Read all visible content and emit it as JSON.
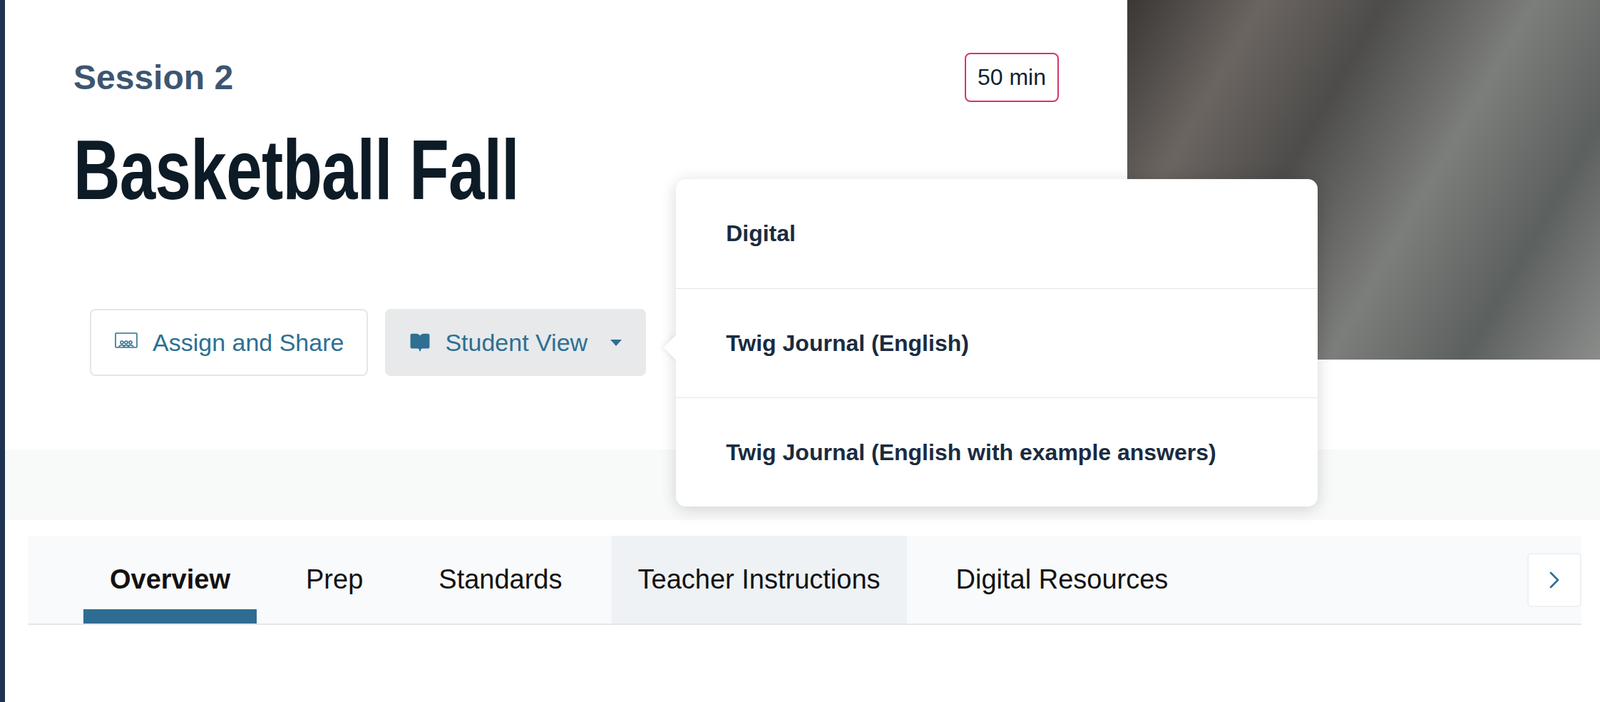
{
  "header": {
    "session": "Session 2",
    "duration": "50 min",
    "title": "Basketball Fall"
  },
  "actions": {
    "assign": {
      "label": "Assign and Share"
    },
    "student_view": {
      "label": "Student View",
      "expanded": true
    }
  },
  "menu": {
    "items": [
      {
        "label": "Digital"
      },
      {
        "label": "Twig Journal (English)"
      },
      {
        "label": "Twig Journal (English with example answers)"
      }
    ]
  },
  "tabs": [
    {
      "label": "Overview",
      "selected": true,
      "highlighted": false
    },
    {
      "label": "Prep",
      "selected": false,
      "highlighted": false
    },
    {
      "label": "Standards",
      "selected": false,
      "highlighted": false
    },
    {
      "label": "Teacher Instructions",
      "selected": false,
      "highlighted": true
    },
    {
      "label": "Digital Resources",
      "selected": false,
      "highlighted": false
    }
  ]
}
